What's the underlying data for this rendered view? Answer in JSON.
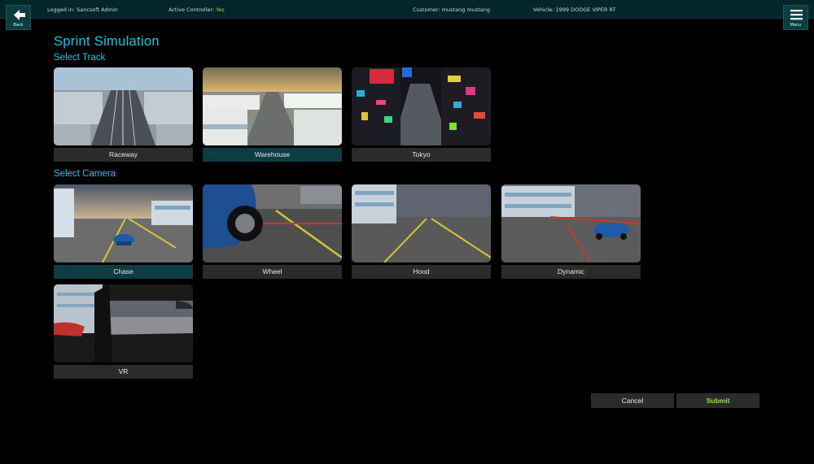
{
  "header": {
    "logged_in": "Logged in: Sancsoft Admin",
    "active_controller_label": "Active Controller: ",
    "active_controller_value": "Yes",
    "customer": "Customer: mustang mustang",
    "vehicle": "Vehicle: 1999 DODGE VIPER RT",
    "back_label": "Back",
    "menu_label": "Menu"
  },
  "page": {
    "title": "Sprint Simulation",
    "track_heading": "Select Track",
    "camera_heading": "Select Camera"
  },
  "tracks": [
    {
      "label": "Raceway",
      "selected": false
    },
    {
      "label": "Warehouse",
      "selected": true
    },
    {
      "label": "Tokyo",
      "selected": false
    }
  ],
  "cameras": [
    {
      "label": "Chase",
      "selected": true
    },
    {
      "label": "Wheel",
      "selected": false
    },
    {
      "label": "Hood",
      "selected": false
    },
    {
      "label": "Dynamic",
      "selected": false
    },
    {
      "label": "VR",
      "selected": false
    }
  ],
  "actions": {
    "cancel_label": "Cancel",
    "submit_label": "Submit"
  },
  "colors": {
    "accent": "#16c5e0",
    "selected_label_bg": "#0e3c43",
    "submit_text": "#8ee43a",
    "topbar_bg": "#03262b"
  }
}
